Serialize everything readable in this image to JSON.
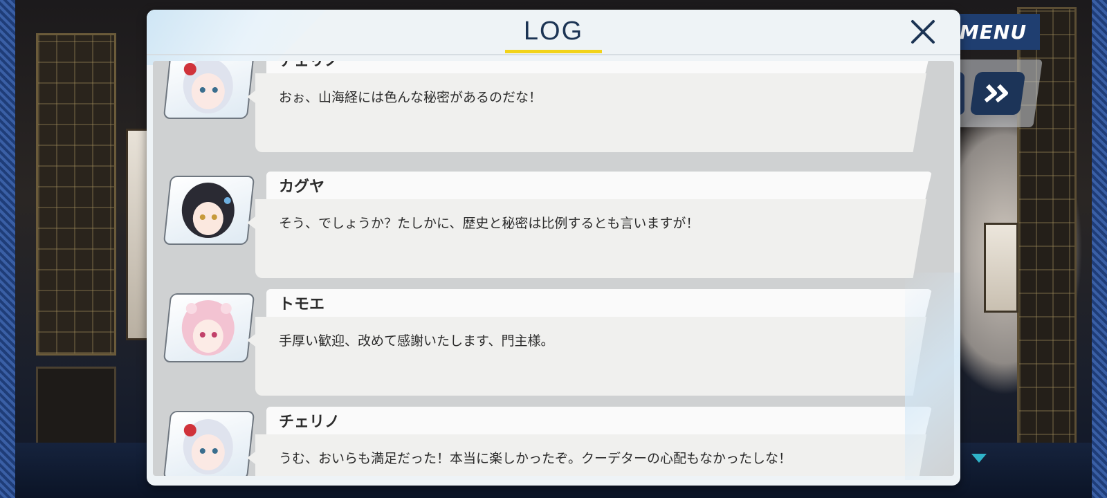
{
  "hud": {
    "menu_label": "MENU",
    "auto_icon": "auto-play-icon",
    "skip_icon": "fast-forward-icon",
    "next_indicator_icon": "triangle-down-icon"
  },
  "log_dialog": {
    "title": "LOG",
    "close_icon": "close-icon",
    "accent_color": "#f2d31a",
    "entries": [
      {
        "speaker": "チェリノ",
        "message": "おぉ、山海経には色んな秘密があるのだな！",
        "portrait": "cherino-portrait"
      },
      {
        "speaker": "カグヤ",
        "message": "そう、でしょうか？たしかに、歴史と秘密は比例するとも言いますが！",
        "portrait": "kaguya-portrait"
      },
      {
        "speaker": "トモエ",
        "message": "手厚い歓迎、改めて感謝いたします、門主様。",
        "portrait": "tomoe-portrait"
      },
      {
        "speaker": "チェリノ",
        "message": "うむ、おいらも満足だった！本当に楽しかったぞ。クーデターの心配もなかったしな！",
        "portrait": "cherino-portrait"
      }
    ]
  }
}
